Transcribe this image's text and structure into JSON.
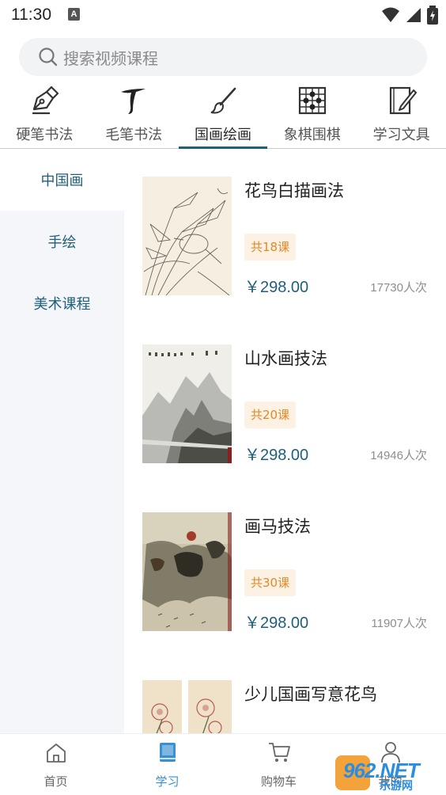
{
  "status": {
    "time": "11:30",
    "notification_glyph": "A"
  },
  "search": {
    "placeholder": "搜索视频课程"
  },
  "categories": [
    {
      "label": "硬笔书法",
      "icon": "fountain-pen-icon"
    },
    {
      "label": "毛笔书法",
      "icon": "calligraphy-brush-icon"
    },
    {
      "label": "国画绘画",
      "icon": "paint-brush-icon",
      "active": true
    },
    {
      "label": "象棋围棋",
      "icon": "chessboard-icon"
    },
    {
      "label": "学习文具",
      "icon": "notebook-pencil-icon"
    }
  ],
  "sidebar": {
    "items": [
      {
        "label": "中国画",
        "active": true
      },
      {
        "label": "手绘"
      },
      {
        "label": "美术课程"
      }
    ]
  },
  "courses": [
    {
      "title": "花鸟白描画法",
      "badge": "共18课",
      "price": "￥298.00",
      "count": "17730人次"
    },
    {
      "title": "山水画技法",
      "badge": "共20课",
      "price": "￥298.00",
      "count": "14946人次"
    },
    {
      "title": "画马技法",
      "badge": "共30课",
      "price": "￥298.00",
      "count": "11907人次"
    },
    {
      "title": "少儿国画写意花鸟"
    }
  ],
  "bottom_nav": {
    "items": [
      {
        "label": "首页",
        "icon": "home-icon"
      },
      {
        "label": "学习",
        "icon": "book-icon",
        "active": true
      },
      {
        "label": "购物车",
        "icon": "cart-icon"
      },
      {
        "label": "我的",
        "icon": "user-icon"
      }
    ]
  },
  "watermark": {
    "brand": "962.NET",
    "sub": "乐游网"
  },
  "colors": {
    "accent": "#1f5f7a",
    "active_nav": "#3a8fd0",
    "badge_text": "#e08a28",
    "badge_bg": "#fdf1e4",
    "sidebar_bg": "#f4f6fa"
  }
}
